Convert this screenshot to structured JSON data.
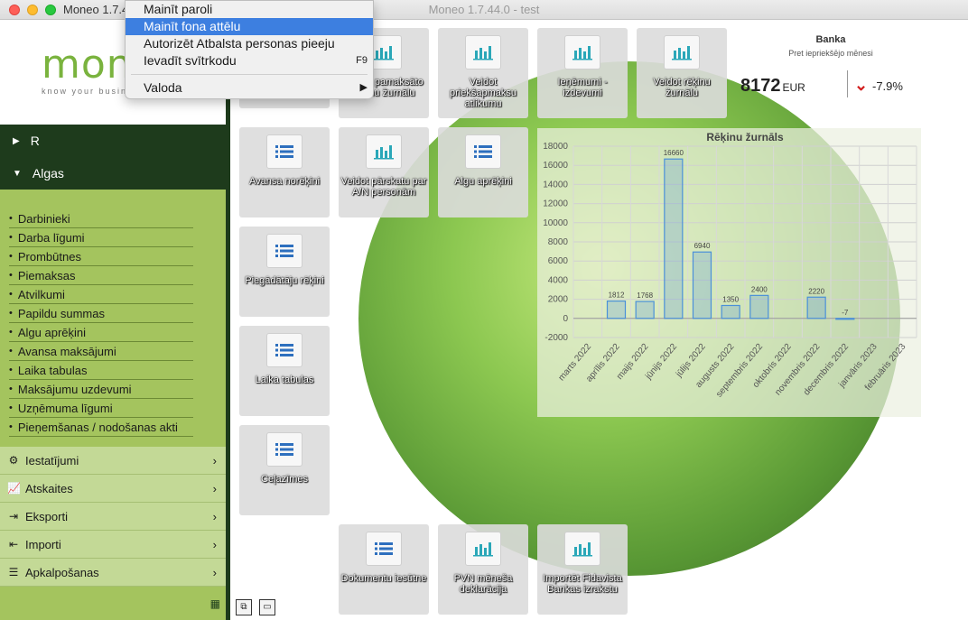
{
  "window": {
    "title_left": "Moneo 1.7.4",
    "title_center": "Moneo 1.7.44.0 - test"
  },
  "logo": {
    "text": "mon",
    "tagline": "know your busin"
  },
  "sidebar": {
    "collapsed_section": "R",
    "expanded_section": "Algas",
    "items": [
      "Darbinieki",
      "Darba līgumi",
      "Prombūtnes",
      "Piemaksas",
      "Atvilkumi",
      "Papildu summas",
      "Algu aprēķini",
      "Avansa maksājumi",
      "Laika tabulas",
      "Maksājumu uzdevumi",
      "Uzņēmuma līgumi",
      "Pieņemšanas / nodošanas akti"
    ],
    "sections": [
      {
        "label": "Iestatījumi",
        "icon": "gear-icon"
      },
      {
        "label": "Atskaites",
        "icon": "chart-icon"
      },
      {
        "label": "Eksporti",
        "icon": "export-icon"
      },
      {
        "label": "Importi",
        "icon": "import-icon"
      },
      {
        "label": "Apkalpošanas",
        "icon": "server-icon"
      }
    ]
  },
  "tiles": {
    "r0c1": "Veidot pamaksāto rēķinu žurnālu",
    "r0c2": "Veidot priekšapmaksu atlikumu",
    "r0c3": "Ieņēmumi - izdevumi",
    "r0c4": "Veidot rēķinu žurnālu",
    "r1c0": "Avansa norēķini",
    "r1c1": "Veidot pārskatu par A/N personām",
    "r1c2": "Algu aprēķini",
    "r2c0": "Piegādātāju rēķini",
    "r3c0": "Laika tabulas",
    "r4c0": "Ceļazīmes",
    "b0": "Dokumentu iesūtne",
    "b1": "PVN mēneša deklarācija",
    "b2": "Importēt Fidavista Bankas izrakstu"
  },
  "banka": {
    "title": "Banka",
    "subtitle": "Pret iepriekšējo mēnesi",
    "value": "8172",
    "currency": "EUR",
    "change": "-7.9%",
    "trend_color": "#d21d1d"
  },
  "menu": {
    "items": [
      "Mainīt paroli",
      "Mainīt fona attēlu",
      "Autorizēt Atbalsta personas pieeju",
      "Ievadīt svītrkodu",
      "Valoda"
    ],
    "selected_index": 1,
    "shortcut": "F9",
    "submenu_indicator": "▶"
  },
  "chart_data": {
    "type": "bar",
    "title": "Rēķinu žurnāls",
    "categories": [
      "marts 2022",
      "aprīlis 2022",
      "maijs 2022",
      "jūnijs 2022",
      "jūlijs 2022",
      "augusts 2022",
      "septembris 2022",
      "oktobris 2022",
      "novembris 2022",
      "decembris 2022",
      "janvāris 2023",
      "februāris 2023"
    ],
    "values": [
      null,
      1812,
      1768,
      16660,
      6940,
      1350,
      2400,
      null,
      2220,
      -7,
      null,
      null
    ],
    "value_labels": [
      "",
      "1812",
      "1768",
      "16660",
      "6940",
      "1350",
      "2400",
      "",
      "2220",
      "-7",
      "",
      ""
    ],
    "ylim": [
      -2000,
      18000
    ],
    "yticks": [
      "18000",
      "16000",
      "14000",
      "12000",
      "10000",
      "8000",
      "6000",
      "4000",
      "2000",
      "0",
      "-2000"
    ],
    "grid": true,
    "bar_color": "#4a90d9"
  }
}
